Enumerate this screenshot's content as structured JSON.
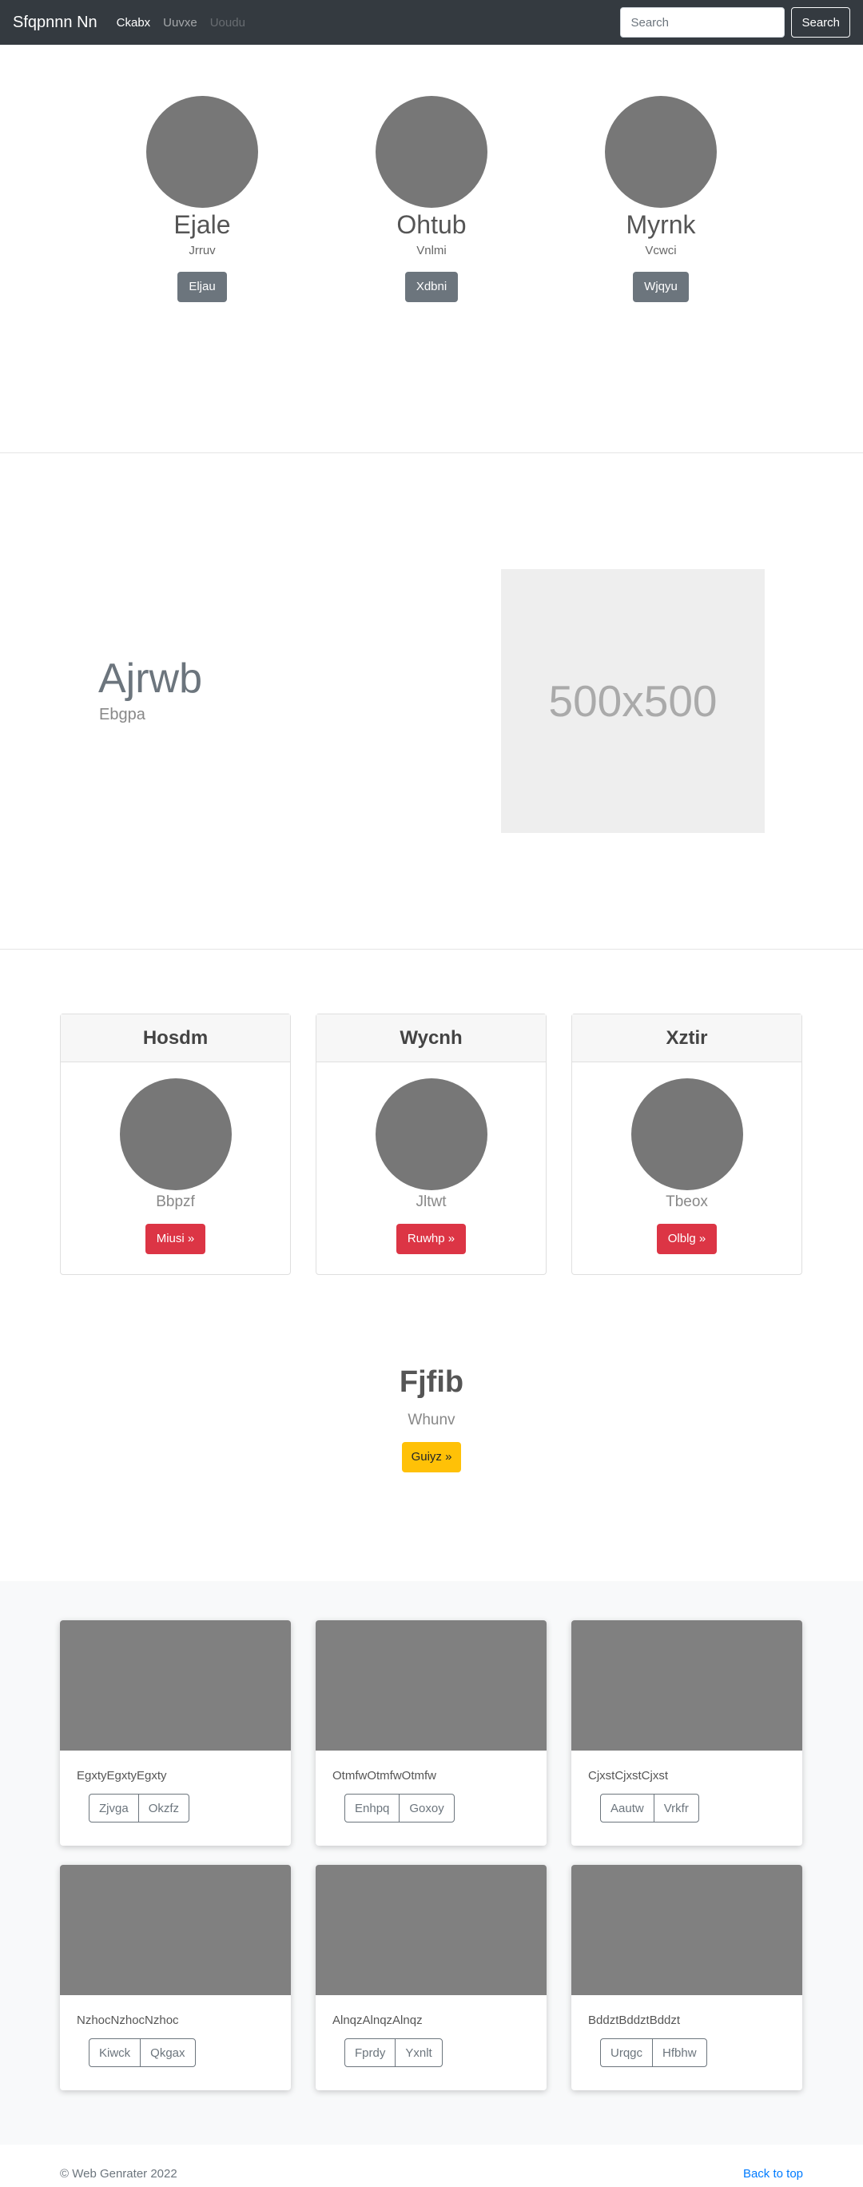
{
  "navbar": {
    "brand": "Sfqpnnn Nn",
    "links": [
      {
        "label": "Ckabx",
        "state": "active"
      },
      {
        "label": "Uuvxe",
        "state": "normal"
      },
      {
        "label": "Uoudu",
        "state": "disabled"
      }
    ],
    "search_placeholder": "Search",
    "search_button": "Search"
  },
  "team": [
    {
      "name": "Ejale",
      "role": "Jrruv",
      "button": "Eljau"
    },
    {
      "name": "Ohtub",
      "role": "Vnlmi",
      "button": "Xdbni"
    },
    {
      "name": "Myrnk",
      "role": "Vcwci",
      "button": "Wjqyu"
    }
  ],
  "feature": {
    "heading": "Ajrwb",
    "lead": "Ebgpa",
    "image_label": "500x500"
  },
  "cards": [
    {
      "header": "Hosdm",
      "subtitle": "Bbpzf",
      "button": "Miusi »"
    },
    {
      "header": "Wycnh",
      "subtitle": "Jltwt",
      "button": "Ruwhp »"
    },
    {
      "header": "Xztir",
      "subtitle": "Tbeox",
      "button": "Olblg »"
    }
  ],
  "jumbotron": {
    "title": "Fjfib",
    "lead": "Whunv",
    "button": "Guiyz »"
  },
  "album": [
    {
      "text": "EgxtyEgxtyEgxty",
      "buttons": [
        "Zjvga",
        "Okzfz"
      ]
    },
    {
      "text": "OtmfwOtmfwOtmfw",
      "buttons": [
        "Enhpq",
        "Goxoy"
      ]
    },
    {
      "text": "CjxstCjxstCjxst",
      "buttons": [
        "Aautw",
        "Vrkfr"
      ]
    },
    {
      "text": "NzhocNzhocNzhoc",
      "buttons": [
        "Kiwck",
        "Qkgax"
      ]
    },
    {
      "text": "AlnqzAlnqzAlnqz",
      "buttons": [
        "Fprdy",
        "Yxnlt"
      ]
    },
    {
      "text": "BddztBddztBddzt",
      "buttons": [
        "Urqgc",
        "Hfbhw"
      ]
    }
  ],
  "footer": {
    "copyright": "© Web Genrater 2022",
    "back_to_top": "Back to top"
  },
  "colors": {
    "navbar_bg": "#343a40",
    "button_gray": "#6c757d",
    "button_red": "#dc3545",
    "button_yellow": "#ffc107",
    "link_blue": "#007bff",
    "placeholder": "#808080"
  }
}
